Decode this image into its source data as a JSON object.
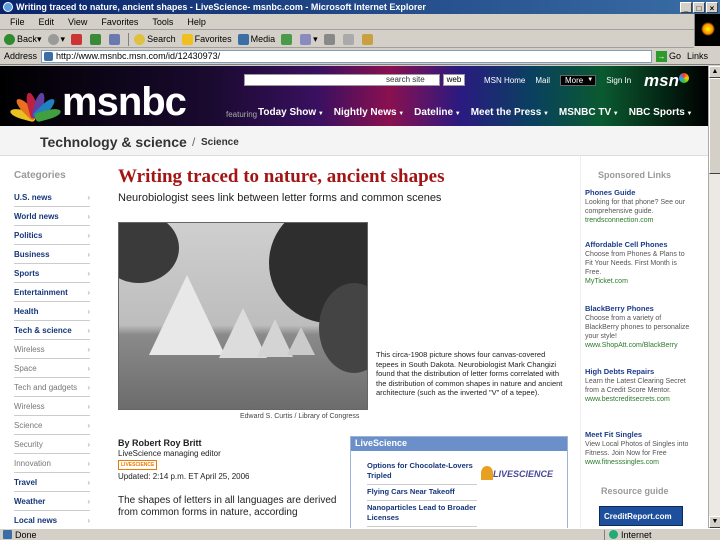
{
  "window": {
    "title": "Writing traced to nature, ancient shapes - LiveScience- msnbc.com - Microsoft Internet Explorer",
    "buttons": [
      "_",
      "□",
      "×"
    ]
  },
  "menu": [
    "File",
    "Edit",
    "View",
    "Favorites",
    "Tools",
    "Help"
  ],
  "toolbar": {
    "back": "Back",
    "search": "Search",
    "favorites": "Favorites",
    "media": "Media"
  },
  "address": {
    "label": "Address",
    "url": "http://www.msnbc.msn.com/id/12430973/",
    "go": "Go",
    "links": "Links"
  },
  "header": {
    "search_label": "search site",
    "web_button": "web",
    "top_links": [
      "MSN Home",
      "Mail"
    ],
    "more": "More",
    "sign_in": "Sign In",
    "msn": "msn",
    "logo": "msnbc",
    "featuring": "featuring",
    "nav": [
      "Today Show",
      "Nightly News",
      "Dateline",
      "Meet the Press",
      "MSNBC TV",
      "NBC Sports"
    ]
  },
  "section": {
    "title": "Technology & science",
    "separator": "/",
    "sub": "Science"
  },
  "sidebar": {
    "heading": "Categories",
    "items": [
      {
        "label": "U.S. news",
        "style": "bold"
      },
      {
        "label": "World news",
        "style": "bold"
      },
      {
        "label": "Politics",
        "style": "bold"
      },
      {
        "label": "Business",
        "style": "bold"
      },
      {
        "label": "Sports",
        "style": "bold"
      },
      {
        "label": "Entertainment",
        "style": "bold"
      },
      {
        "label": "Health",
        "style": "bold"
      },
      {
        "label": "Tech & science",
        "style": "bold"
      },
      {
        "label": "Wireless",
        "style": "light"
      },
      {
        "label": "Space",
        "style": "light"
      },
      {
        "label": "Tech and gadgets",
        "style": "light"
      },
      {
        "label": "Wireless",
        "style": "light"
      },
      {
        "label": "Science",
        "style": "light"
      },
      {
        "label": "Security",
        "style": "light"
      },
      {
        "label": "Innovation",
        "style": "light"
      },
      {
        "label": "Travel",
        "style": "bold"
      },
      {
        "label": "Weather",
        "style": "bold"
      },
      {
        "label": "Local news",
        "style": "bold"
      }
    ]
  },
  "article": {
    "headline": "Writing traced to nature, ancient shapes",
    "subhead": "Neurobiologist sees link between letter forms and common scenes",
    "photo_credit": "Edward S. Curtis / Library of Congress",
    "caption": "This circa-1908 picture shows four canvas-covered tepees in South Dakota. Neurobiologist Mark Changizi found that the distribution of letter forms correlated with the distribution of common shapes in nature and ancient architecture (such as the inverted \"V\" of a tepee).",
    "byline": "By Robert Roy Britt",
    "role": "LiveScience managing editor",
    "badge": "LIVESCIENCE",
    "dated": "Updated: 2:14 p.m. ET April 25, 2006",
    "body": "The shapes of letters in all languages are derived from common forms in nature, according"
  },
  "livescience": {
    "heading": "LiveScience",
    "logo": "LIVESCIENCE",
    "items": [
      "Options for Chocolate-Lovers Tripled",
      "Flying Cars Near Takeoff",
      "Nanoparticles Lead to Broader Licenses"
    ]
  },
  "sponsored": {
    "heading": "Sponsored Links",
    "ads": [
      {
        "title": "Phones Guide",
        "desc": "Looking for that phone? See our comprehensive guide.",
        "url": "trendsconnection.com"
      },
      {
        "title": "Affordable Cell Phones",
        "desc": "Choose from Phones & Plans to Fit Your Needs. First Month is Free.",
        "url": "MyTicket.com"
      },
      {
        "title": "BlackBerry Phones",
        "desc": "Choose from a variety of BlackBerry phones to personalize your style!",
        "url": "www.ShopAtt.com/BlackBerry"
      },
      {
        "title": "High Debts Repairs",
        "desc": "Learn the Latest Clearing Secret from a Credit Score Mentor.",
        "url": "www.bestcreditsecrets.com"
      },
      {
        "title": "Meet Fit Singles",
        "desc": "View Local Photos of Singles into Fitness. Join Now for Free",
        "url": "www.fitnesssingles.com"
      }
    ],
    "resource_heading": "Resource guide",
    "credit_report": "CreditReport.com"
  },
  "status": {
    "text": "Done",
    "zone": "Internet"
  },
  "colors": {
    "headline": "#a31515",
    "link": "#14367a",
    "titlebar": "#0a246a"
  }
}
